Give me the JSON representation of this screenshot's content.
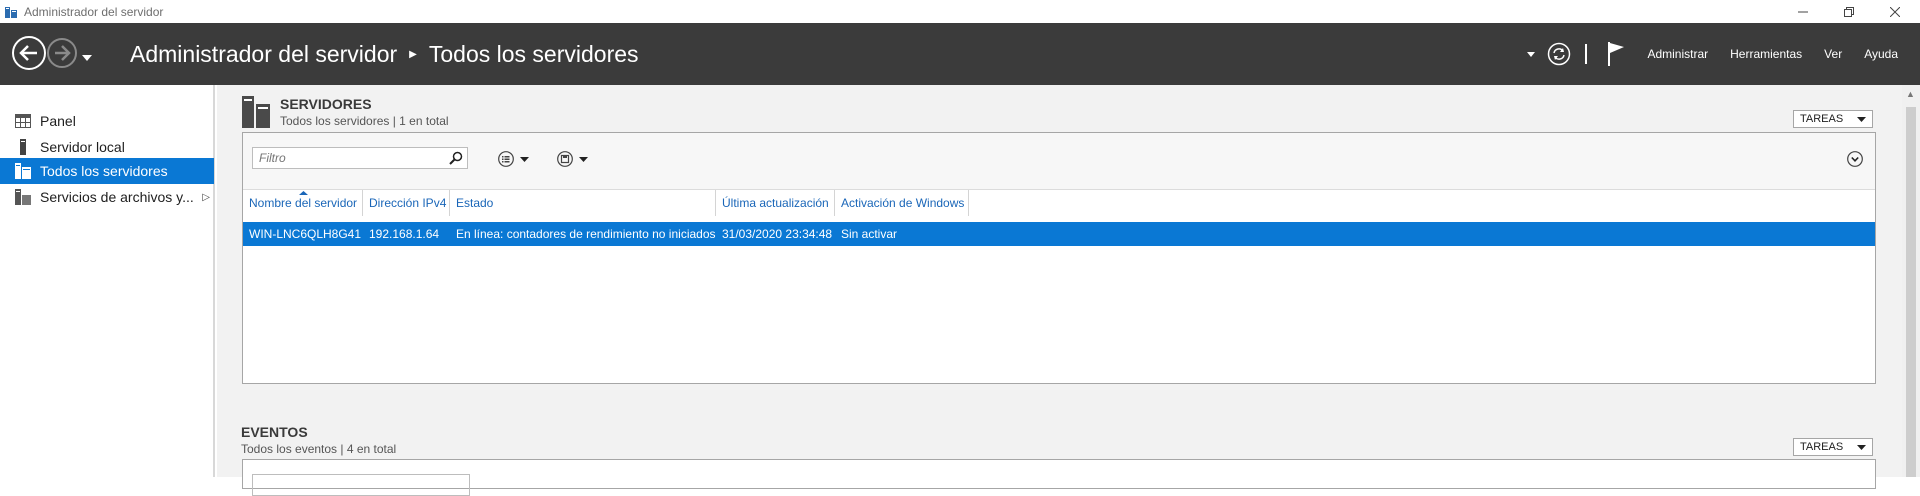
{
  "window": {
    "title": "Administrador del servidor"
  },
  "header": {
    "breadcrumb": [
      "Administrador del servidor",
      "Todos los servidores"
    ],
    "menu": [
      "Administrar",
      "Herramientas",
      "Ver",
      "Ayuda"
    ]
  },
  "sidebar": {
    "items": [
      {
        "label": "Panel",
        "icon": "dashboard-icon",
        "active": false
      },
      {
        "label": "Servidor local",
        "icon": "server-icon",
        "active": false
      },
      {
        "label": "Todos los servidores",
        "icon": "servers-icon",
        "active": true
      },
      {
        "label": "Servicios de archivos y...",
        "icon": "file-services-icon",
        "active": false,
        "expandable": true
      }
    ]
  },
  "servers": {
    "title": "SERVIDORES",
    "subtitle": "Todos los servidores | 1 en total",
    "tasks_label": "TAREAS",
    "filter_placeholder": "Filtro",
    "columns": [
      "Nombre del servidor",
      "Dirección IPv4",
      "Estado",
      "Última actualización",
      "Activación de Windows"
    ],
    "sort_column": "Nombre del servidor",
    "rows": [
      {
        "name": "WIN-LNC6QLH8G41",
        "ip": "192.168.1.64",
        "status": "En línea: contadores de rendimiento no iniciados",
        "updated": "31/03/2020 23:34:48",
        "activation": "Sin activar",
        "selected": true
      }
    ]
  },
  "events": {
    "title": "EVENTOS",
    "subtitle": "Todos los eventos | 4 en total",
    "tasks_label": "TAREAS"
  },
  "colors": {
    "header_bg": "#3b3b3b",
    "accent": "#0a78d4",
    "link": "#1a66b8"
  }
}
